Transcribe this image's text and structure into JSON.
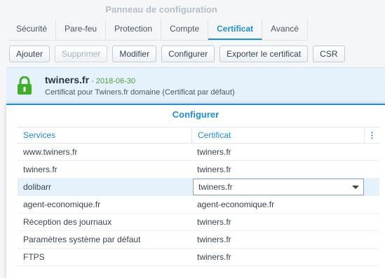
{
  "window": {
    "title": "Panneau de configuration"
  },
  "tabs": [
    {
      "label": "Sécurité"
    },
    {
      "label": "Pare-feu"
    },
    {
      "label": "Protection"
    },
    {
      "label": "Compte"
    },
    {
      "label": "Certificat",
      "active": true
    },
    {
      "label": "Avancé"
    }
  ],
  "toolbar": {
    "add": "Ajouter",
    "delete": "Supprimer",
    "edit": "Modifier",
    "configure": "Configurer",
    "export": "Exporter le certificat",
    "csr": "CSR"
  },
  "certificate": {
    "name": "twiners.fr",
    "date": " - 2018-06-30",
    "description": "Certificat pour Twiners.fr domaine (Certificat par défaut)",
    "icon": "lock-icon",
    "status_color": "#3fae29"
  },
  "dialog": {
    "title": "Configurer",
    "columns": {
      "services": "Services",
      "certificate": "Certificat",
      "menu": "⋮"
    },
    "rows": [
      {
        "service": "www.twiners.fr",
        "certificate": "twiners.fr"
      },
      {
        "service": "twiners.fr",
        "certificate": "twiners.fr"
      },
      {
        "service": "dolibarr",
        "certificate": "twiners.fr",
        "selected": true
      },
      {
        "service": "agent-economique.fr",
        "certificate": "agent-economique.fr"
      },
      {
        "service": "Réception des journaux",
        "certificate": "twiners.fr"
      },
      {
        "service": "Paramètres système par défaut",
        "certificate": "twiners.fr"
      },
      {
        "service": "FTPS",
        "certificate": "twiners.fr"
      }
    ]
  },
  "colors": {
    "accent": "#1f8fd6",
    "selection": "#e6f2fb"
  }
}
